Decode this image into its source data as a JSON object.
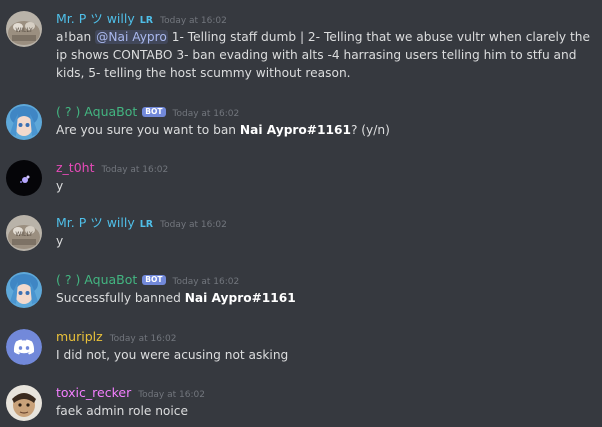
{
  "colors": {
    "background": "#36393f",
    "timestamp": "#72767d",
    "text": "#dcddde",
    "mention_bg": "#414675",
    "bot_badge": "#7289da"
  },
  "messages": [
    {
      "author": "Mr. P ツ willy",
      "tag": "LR",
      "author_color": "#4fbfe8",
      "timestamp": "Today at 16:02",
      "text": {
        "prefix": "a!ban ",
        "mention": "@Nai Aypro",
        "rest": " 1- Telling staff dumb | 2- Telling that we abuse vultr when clarely the ip shows CONTABO 3- ban evading with alts -4 harrasing users telling him to stfu and kids, 5- telling the host scummy without reason."
      }
    },
    {
      "author": "( ? ) AquaBot",
      "badge": "BOT",
      "author_color": "#43b581",
      "timestamp": "Today at 16:02",
      "text": {
        "prefix": "Are you sure you want to ban ",
        "bold": "Nai Aypro#1161",
        "suffix": "? (y/n)"
      }
    },
    {
      "author": "z_t0ht",
      "author_color": "#e64ab8",
      "timestamp": "Today at 16:02",
      "text": "y"
    },
    {
      "author": "Mr. P ツ willy",
      "tag": "LR",
      "author_color": "#4fbfe8",
      "timestamp": "Today at 16:02",
      "text": "y"
    },
    {
      "author": "( ? ) AquaBot",
      "badge": "BOT",
      "author_color": "#43b581",
      "timestamp": "Today at 16:02",
      "text": {
        "prefix": "Successfully banned ",
        "bold": "Nai Aypro#1161"
      }
    },
    {
      "author": "muriplz",
      "author_color": "#e9c13a",
      "timestamp": "Today at 16:02",
      "text": "I did not, you were acusing not asking"
    },
    {
      "author": "toxic_recker",
      "author_color": "#f47fff",
      "timestamp": "Today at 16:02",
      "text": "faek admin role noice"
    }
  ]
}
